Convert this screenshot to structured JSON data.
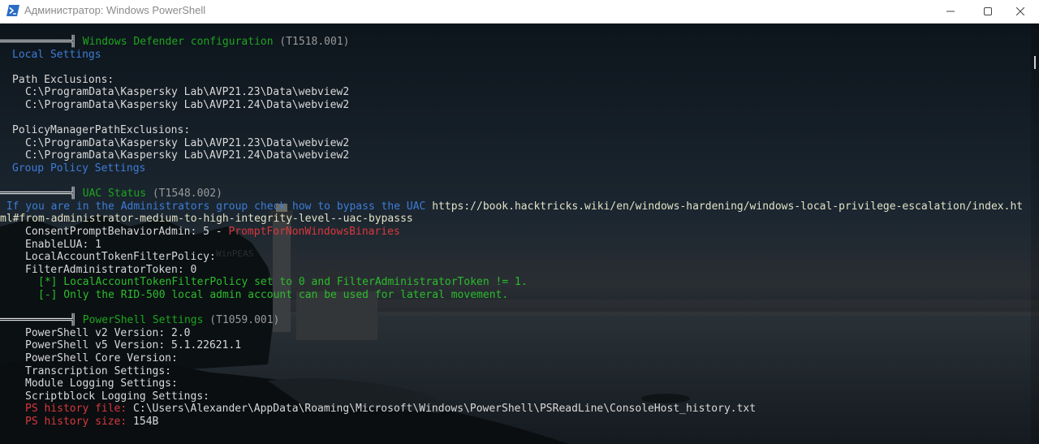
{
  "window": {
    "title": "Администратор: Windows PowerShell",
    "icon": "powershell-icon",
    "controls": [
      "minimize-icon",
      "maximize-icon",
      "close-icon"
    ]
  },
  "colors": {
    "title_bar": "#ffffff",
    "console_text": "#d9d9d9",
    "section_header": "#1ea51e",
    "info_blue": "#3e7cd6",
    "technique_id": "#9a9a9a",
    "alert_red": "#d8383c"
  },
  "watermark_text": "WinPEAS",
  "sections": {
    "defender": {
      "header_bar": "═══════════╣",
      "title": " Windows Defender configuration",
      "technique": " (T1518.001)",
      "local_settings": "Local Settings",
      "path_exclusions_label": "Path Exclusions:",
      "path_exclusions": [
        "C:\\ProgramData\\Kaspersky Lab\\AVP21.23\\Data\\webview2",
        "C:\\ProgramData\\Kaspersky Lab\\AVP21.24\\Data\\webview2"
      ],
      "policy_label": "PolicyManagerPathExclusions:",
      "policy_exclusions": [
        "C:\\ProgramData\\Kaspersky Lab\\AVP21.23\\Data\\webview2",
        "C:\\ProgramData\\Kaspersky Lab\\AVP21.24\\Data\\webview2"
      ],
      "group_policy": "Group Policy Settings"
    },
    "uac": {
      "header_bar": "═══════════╣",
      "title": " UAC Status",
      "technique": " (T1548.002)",
      "hint_prefix": " If you are in the Administrators group check how to bypass the UAC",
      "hint_url_1": " https://book.hacktricks.wiki/en/windows-hardening/windows-local-privilege-escalation/index.ht",
      "hint_url_2": "ml#from-administrator-medium-to-high-integrity-level--uac-bypasss",
      "consent_label": "ConsentPromptBehaviorAdmin: 5 - ",
      "consent_value": "PromptForNonWindowsBinaries",
      "enable_lua": "EnableLUA: 1",
      "local_token": "LocalAccountTokenFilterPolicy:",
      "filter_admin": "FilterAdministratorToken: 0",
      "note_1": "[*] LocalAccountTokenFilterPolicy set to 0 and FilterAdministratorToken != 1.",
      "note_2": "[-] Only the RID-500 local admin account can be used for lateral movement."
    },
    "powershell": {
      "header_bar": "═══════════╣",
      "title": " PowerShell Settings",
      "technique": " (T1059.001)",
      "v2": "PowerShell v2 Version: 2.0",
      "v5": "PowerShell v5 Version: 5.1.22621.1",
      "core": "PowerShell Core Version:",
      "transcription": "Transcription Settings:",
      "module_logging": "Module Logging Settings:",
      "scriptblock": "Scriptblock Logging Settings:",
      "history_file_label": "PS history file:",
      "history_file_value": " C:\\Users\\Alexander\\AppData\\Roaming\\Microsoft\\Windows\\PowerShell\\PSReadLine\\ConsoleHost_history.txt",
      "history_size_label": "PS history size:",
      "history_size_value": " 154B"
    }
  }
}
